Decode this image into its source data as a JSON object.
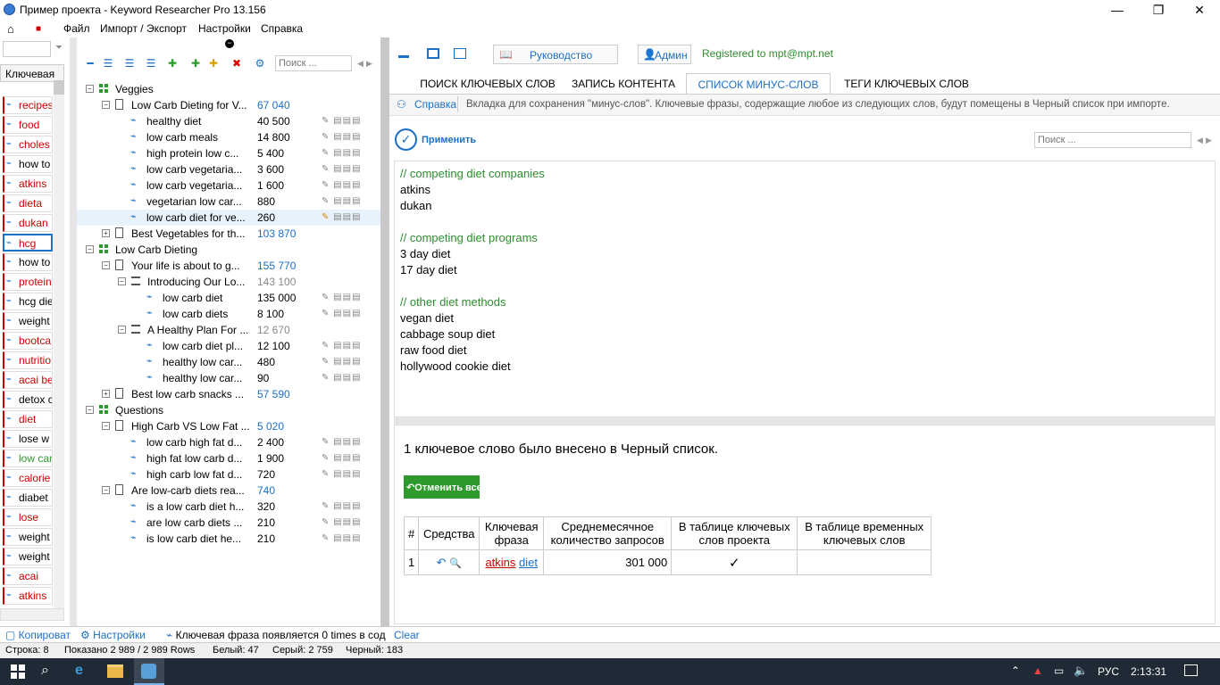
{
  "window": {
    "title": "Пример проекта - Keyword Researcher Pro 13.156",
    "min": "—",
    "max": "❐",
    "close": "✕"
  },
  "menu": {
    "home": "⌂",
    "save": "■",
    "items": [
      "Файл",
      "Импорт / Экспорт",
      "Настройки",
      "Справка"
    ]
  },
  "left_list": {
    "header": "Ключевая",
    "items": [
      {
        "text": "recipes",
        "color": "#c00"
      },
      {
        "text": "food",
        "color": "#c00"
      },
      {
        "text": "choles",
        "color": "#c00"
      },
      {
        "text": "how to",
        "color": "#000"
      },
      {
        "text": "atkins",
        "color": "#c00"
      },
      {
        "text": "dieta",
        "color": "#c00"
      },
      {
        "text": "dukan",
        "color": "#c00"
      },
      {
        "text": "hcg",
        "color": "#c00"
      },
      {
        "text": "how to",
        "color": "#000"
      },
      {
        "text": "protein",
        "color": "#c00"
      },
      {
        "text": "hcg die",
        "color": "#000"
      },
      {
        "text": "weight",
        "color": "#000"
      },
      {
        "text": "bootca",
        "color": "#c00"
      },
      {
        "text": "nutritio",
        "color": "#c00"
      },
      {
        "text": "acai be",
        "color": "#c00"
      },
      {
        "text": "detox c",
        "color": "#000"
      },
      {
        "text": "diet",
        "color": "#c00"
      },
      {
        "text": "lose w",
        "color": "#000"
      },
      {
        "text": "low car",
        "color": "#2e9a2e"
      },
      {
        "text": "calorie",
        "color": "#c00"
      },
      {
        "text": "diabet",
        "color": "#000"
      },
      {
        "text": "lose",
        "color": "#c00"
      },
      {
        "text": "weight",
        "color": "#000"
      },
      {
        "text": "weight",
        "color": "#000"
      },
      {
        "text": "acai",
        "color": "#c00"
      },
      {
        "text": "atkins",
        "color": "#c00"
      }
    ]
  },
  "tree": {
    "search_placeholder": "Поиск ...",
    "rows": [
      {
        "level": 0,
        "type": "group",
        "label": "Veggies",
        "num": "",
        "toggle": "−"
      },
      {
        "level": 1,
        "type": "doc",
        "label": "Low Carb Dieting for V...",
        "num": "67 040",
        "numclass": "blue",
        "toggle": "−"
      },
      {
        "level": 2,
        "type": "kw",
        "label": "healthy diet",
        "num": "40 500",
        "tools": true
      },
      {
        "level": 2,
        "type": "kw",
        "label": "low carb meals",
        "num": "14 800",
        "tools": true
      },
      {
        "level": 2,
        "type": "kw",
        "label": "high protein low c...",
        "num": "5 400",
        "tools": true
      },
      {
        "level": 2,
        "type": "kw",
        "label": "low carb vegetaria...",
        "num": "3 600",
        "tools": true
      },
      {
        "level": 2,
        "type": "kw",
        "label": "low carb vegetaria...",
        "num": "1 600",
        "tools": true
      },
      {
        "level": 2,
        "type": "kw",
        "label": "vegetarian low car...",
        "num": "880",
        "tools": true
      },
      {
        "level": 2,
        "type": "kw",
        "label": "low carb diet for ve...",
        "num": "260",
        "tools": true,
        "selected": true
      },
      {
        "level": 1,
        "type": "doc",
        "label": "Best Vegetables for th...",
        "num": "103 870",
        "numclass": "blue",
        "toggle": "+"
      },
      {
        "level": 0,
        "type": "group",
        "label": "Low Carb Dieting",
        "num": "",
        "toggle": "−"
      },
      {
        "level": 1,
        "type": "doc",
        "label": "Your life is about to g...",
        "num": "155 770",
        "numclass": "blue",
        "toggle": "−"
      },
      {
        "level": 2,
        "type": "list",
        "label": "Introducing Our Lo...",
        "num": "143 100",
        "numclass": "gray",
        "toggle": "−"
      },
      {
        "level": 3,
        "type": "kw",
        "label": "low carb diet",
        "num": "135 000",
        "tools": true
      },
      {
        "level": 3,
        "type": "kw",
        "label": "low carb diets",
        "num": "8 100",
        "tools": true
      },
      {
        "level": 2,
        "type": "list",
        "label": "A Healthy Plan For ...",
        "num": "12 670",
        "numclass": "gray",
        "toggle": "−"
      },
      {
        "level": 3,
        "type": "kw",
        "label": "low carb diet pl...",
        "num": "12 100",
        "tools": true
      },
      {
        "level": 3,
        "type": "kw",
        "label": "healthy low car...",
        "num": "480",
        "tools": true
      },
      {
        "level": 3,
        "type": "kw",
        "label": "healthy low car...",
        "num": "90",
        "tools": true
      },
      {
        "level": 1,
        "type": "doc",
        "label": "Best low carb snacks ...",
        "num": "57 590",
        "numclass": "blue",
        "toggle": "+"
      },
      {
        "level": 0,
        "type": "group",
        "label": "Questions",
        "num": "",
        "toggle": "−"
      },
      {
        "level": 1,
        "type": "doc",
        "label": "High Carb VS Low Fat ...",
        "num": "5 020",
        "numclass": "blue",
        "toggle": "−"
      },
      {
        "level": 2,
        "type": "kw",
        "label": "low carb high fat d...",
        "num": "2 400",
        "tools": true
      },
      {
        "level": 2,
        "type": "kw",
        "label": "high fat low carb d...",
        "num": "1 900",
        "tools": true
      },
      {
        "level": 2,
        "type": "kw",
        "label": "high carb low fat d...",
        "num": "720",
        "tools": true
      },
      {
        "level": 1,
        "type": "doc",
        "label": "Are low-carb diets rea...",
        "num": "740",
        "numclass": "blue",
        "toggle": "−"
      },
      {
        "level": 2,
        "type": "kw",
        "label": "is a low carb diet h...",
        "num": "320",
        "tools": true
      },
      {
        "level": 2,
        "type": "kw",
        "label": "are low carb diets ...",
        "num": "210",
        "tools": true
      },
      {
        "level": 2,
        "type": "kw",
        "label": "is low carb diet he...",
        "num": "210",
        "tools": true
      }
    ]
  },
  "right": {
    "guide_label": "Руководство",
    "admin_label": "Админ",
    "registered": "Registered to mpt@mpt.net",
    "tabs": [
      "ПОИСК КЛЮЧЕВЫХ СЛОВ",
      "ЗАПИСЬ КОНТЕНТА",
      "СПИСОК МИНУС-СЛОВ",
      "ТЕГИ КЛЮЧЕВЫХ СЛОВ"
    ],
    "help_label": "Справка",
    "help_text": "Вкладка для сохранения \"минус-слов\". Ключевые фразы, содержащие любое из следующих слов, будут помещены в Черный список при импорте.",
    "apply_label": "Применить",
    "search_placeholder": "Поиск ...",
    "editor_lines": [
      {
        "text": "// competing diet companies",
        "comment": true
      },
      {
        "text": "atkins",
        "comment": false
      },
      {
        "text": "dukan",
        "comment": false
      },
      {
        "text": "",
        "comment": false
      },
      {
        "text": "// competing diet programs",
        "comment": true
      },
      {
        "text": "3 day diet",
        "comment": false
      },
      {
        "text": "17 day diet",
        "comment": false
      },
      {
        "text": "",
        "comment": false
      },
      {
        "text": "// other diet methods",
        "comment": true
      },
      {
        "text": "vegan diet",
        "comment": false
      },
      {
        "text": "cabbage soup diet",
        "comment": false
      },
      {
        "text": "raw food diet",
        "comment": false
      },
      {
        "text": "hollywood cookie diet",
        "comment": false
      }
    ],
    "result_text": "1 ключевое слово было внесено в Черный список.",
    "cancel_all": "Отменить все",
    "table": {
      "headers": [
        "#",
        "Средства",
        "Ключевая фраза",
        "Среднемесячное количество запросов",
        "В таблице ключевых слов проекта",
        "В таблице временных ключевых слов"
      ],
      "row": {
        "num": "1",
        "kw1": "atkins",
        "kw2": "diet",
        "volume": "301 000",
        "in_project": "✓",
        "in_temp": ""
      }
    }
  },
  "status1": {
    "copy": "Копироват",
    "settings": "Настройки",
    "phrase_info": "Ключевая фраза появляется 0 times в сод",
    "clear": "Clear"
  },
  "status2": {
    "row": "Строка: 8",
    "shown": "Показано 2 989 / 2 989 Rows",
    "white": "Белый: 47",
    "gray": "Серый: 2 759",
    "black": "Черный: 183"
  },
  "taskbar": {
    "lang": "РУС",
    "time": "2:13:31"
  }
}
